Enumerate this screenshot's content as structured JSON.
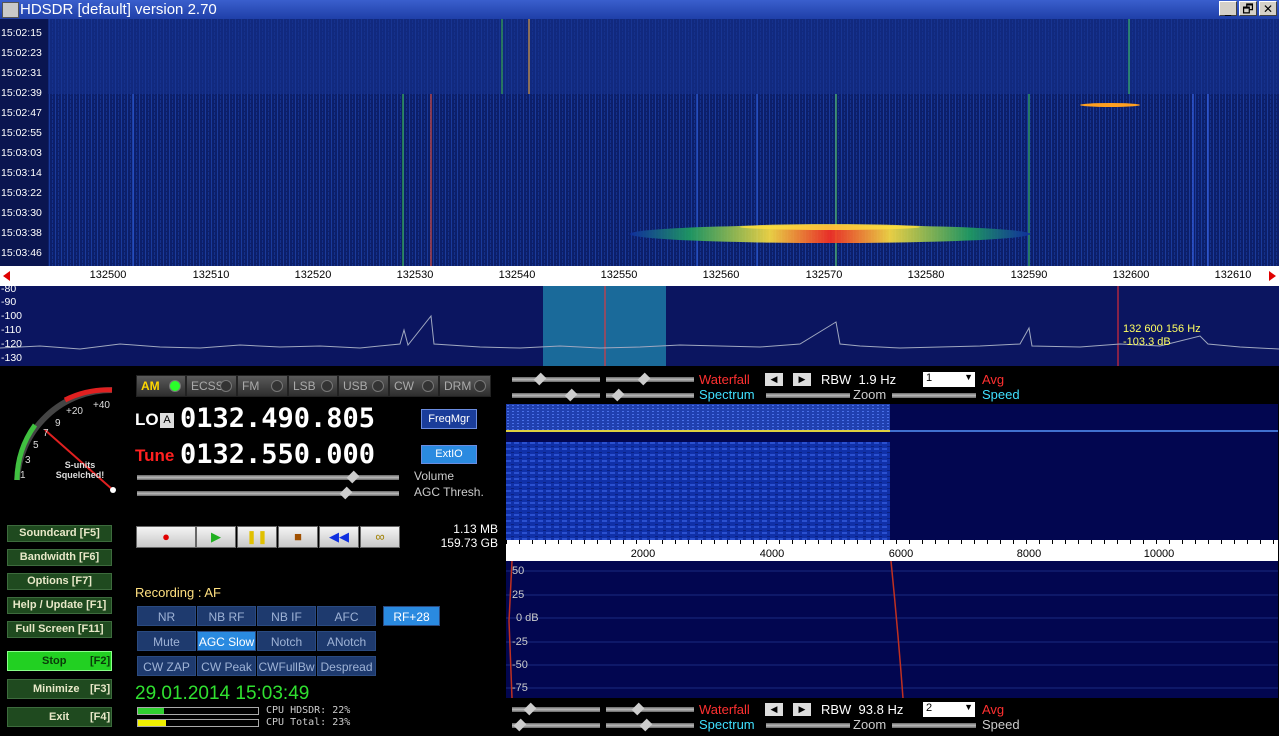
{
  "window": {
    "title": "HDSDR [default]  version 2.70",
    "buttons": [
      "_",
      "🗗",
      "✕"
    ]
  },
  "waterfall_times": [
    "15:02:15",
    "15:02:23",
    "15:02:31",
    "15:02:39",
    "15:02:47",
    "15:02:55",
    "15:03:03",
    "15:03:14",
    "15:03:22",
    "15:03:30",
    "15:03:38",
    "15:03:46"
  ],
  "freq_ticks": [
    "132500",
    "132510",
    "132520",
    "132530",
    "132540",
    "132550",
    "132560",
    "132570",
    "132580",
    "132590",
    "132600",
    "132610"
  ],
  "spectrum": {
    "db_ticks": [
      "-80",
      "-90",
      "-100",
      "-110",
      "-120",
      "-130"
    ],
    "marker_freq": "132 600 156 Hz",
    "marker_level": "-103.3 dB"
  },
  "modes": [
    "AM",
    "ECSS",
    "FM",
    "LSB",
    "USB",
    "CW",
    "DRM"
  ],
  "lo": {
    "label": "LO",
    "badge": "A",
    "value": "0132.490.805",
    "button": "FreqMgr"
  },
  "tune": {
    "label": "Tune",
    "value": "0132.550.000",
    "button": "ExtIO"
  },
  "sliders": {
    "volume": "Volume",
    "agc": "AGC Thresh."
  },
  "smeter": {
    "marks": [
      "1",
      "3",
      "5",
      "7",
      "9",
      "+20",
      "+40"
    ],
    "caption": "S-units\nSquelched!"
  },
  "storage": {
    "file": "1.13 MB",
    "free": "159.73 GB"
  },
  "transport": [
    "●",
    "▶",
    "❚❚",
    "■",
    "◀◀",
    "∞"
  ],
  "recording": "Recording : AF",
  "dsp_row1": [
    "NR",
    "NB RF",
    "NB IF",
    "AFC",
    "RF+28"
  ],
  "dsp_row2": [
    "Mute",
    "AGC Slow",
    "Notch",
    "ANotch"
  ],
  "dsp_row3": [
    "CW ZAP",
    "CW Peak",
    "CWFullBw",
    "Despread"
  ],
  "left_buttons": [
    "Soundcard  [F5]",
    "Bandwidth  [F6]",
    "Options  [F7]",
    "Help / Update  [F1]",
    "Full Screen  [F11]"
  ],
  "left_buttons2": [
    {
      "label": "Stop",
      "key": "[F2]"
    },
    {
      "label": "Minimize",
      "key": "[F3]"
    },
    {
      "label": "Exit",
      "key": "[F4]"
    }
  ],
  "datetime": "29.01.2014 15:03:49",
  "cpu": {
    "hdsdr": "CPU HDSDR: 22%",
    "total": "CPU Total: 23%",
    "hdsdr_level": 0.22,
    "total_level": 0.23
  },
  "rf_controls": {
    "waterfall": "Waterfall",
    "rbw": "RBW  1.9 Hz",
    "avg_value": "1",
    "avg": "Avg",
    "spectrum": "Spectrum",
    "zoom": "Zoom",
    "speed": "Speed"
  },
  "af_controls": {
    "waterfall": "Waterfall",
    "rbw": "RBW  93.8 Hz",
    "avg_value": "2",
    "avg": "Avg",
    "spectrum": "Spectrum",
    "zoom": "Zoom",
    "speed": "Speed"
  },
  "af_ticks": [
    "2000",
    "4000",
    "6000",
    "8000",
    "10000"
  ],
  "af_db_ticks": [
    "50",
    "25",
    "0 dB",
    "-25",
    "-50",
    "-75"
  ],
  "colors": {
    "waterfall_bg": "#0a1a5c",
    "signal_hot": "#ffd000",
    "active_mode": "#ffd700",
    "tune_label": "#ff2020",
    "accent_blue": "#1d4fd0",
    "stop_green": "#22d022"
  }
}
